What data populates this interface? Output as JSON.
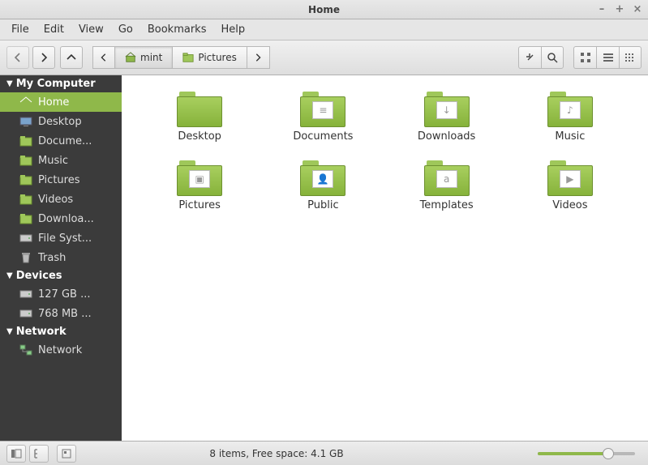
{
  "window": {
    "title": "Home"
  },
  "menu": [
    "File",
    "Edit",
    "View",
    "Go",
    "Bookmarks",
    "Help"
  ],
  "path": {
    "current": "mint",
    "next": "Pictures"
  },
  "sidebar": {
    "sections": [
      {
        "title": "My Computer",
        "items": [
          {
            "label": "Home",
            "icon": "home",
            "active": true
          },
          {
            "label": "Desktop",
            "icon": "desktop"
          },
          {
            "label": "Docume...",
            "icon": "folder"
          },
          {
            "label": "Music",
            "icon": "folder"
          },
          {
            "label": "Pictures",
            "icon": "folder"
          },
          {
            "label": "Videos",
            "icon": "folder"
          },
          {
            "label": "Downloa...",
            "icon": "folder"
          },
          {
            "label": "File Syst...",
            "icon": "drive"
          },
          {
            "label": "Trash",
            "icon": "trash"
          }
        ]
      },
      {
        "title": "Devices",
        "items": [
          {
            "label": "127 GB ...",
            "icon": "drive"
          },
          {
            "label": "768 MB ...",
            "icon": "drive"
          }
        ]
      },
      {
        "title": "Network",
        "items": [
          {
            "label": "Network",
            "icon": "network"
          }
        ]
      }
    ]
  },
  "folders": [
    {
      "name": "Desktop",
      "glyph": ""
    },
    {
      "name": "Documents",
      "glyph": "≡"
    },
    {
      "name": "Downloads",
      "glyph": "↓"
    },
    {
      "name": "Music",
      "glyph": "♪"
    },
    {
      "name": "Pictures",
      "glyph": "▣"
    },
    {
      "name": "Public",
      "glyph": "👤"
    },
    {
      "name": "Templates",
      "glyph": "a"
    },
    {
      "name": "Videos",
      "glyph": "▶"
    }
  ],
  "status": {
    "text": "8 items, Free space: 4.1 GB"
  }
}
